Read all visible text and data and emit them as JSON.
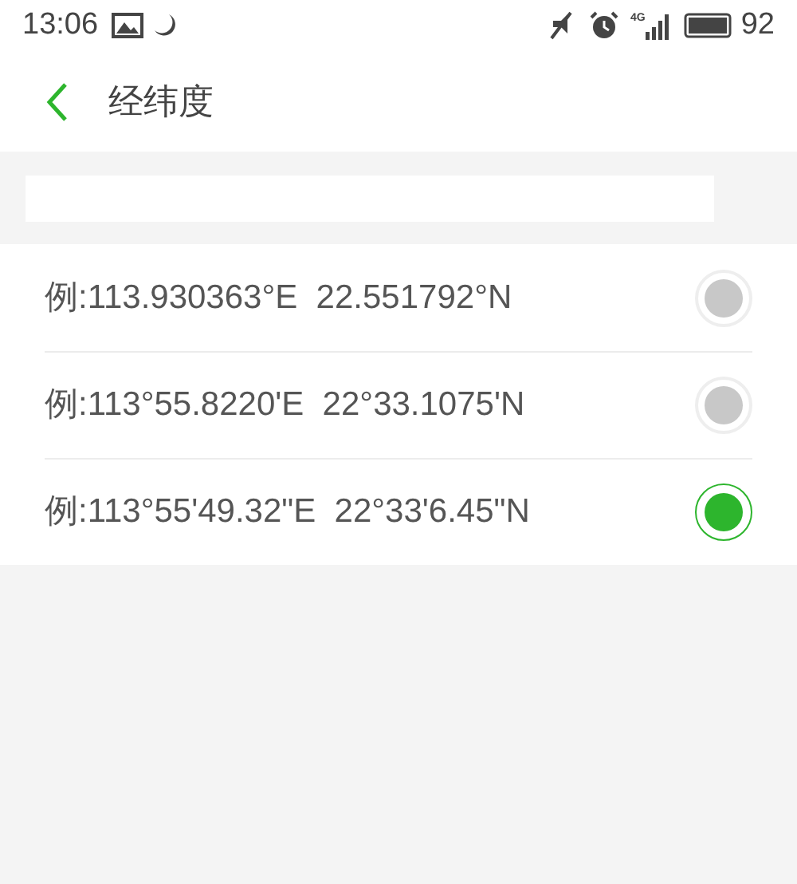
{
  "status_bar": {
    "time": "13:06",
    "network": "4G",
    "battery": "92"
  },
  "header": {
    "title": "经纬度"
  },
  "options": [
    {
      "label": "例:113.930363°E  22.551792°N",
      "selected": false
    },
    {
      "label": "例:113°55.8220'E  22°33.1075'N",
      "selected": false
    },
    {
      "label": "例:113°55'49.32\"E  22°33'6.45\"N",
      "selected": true
    }
  ]
}
